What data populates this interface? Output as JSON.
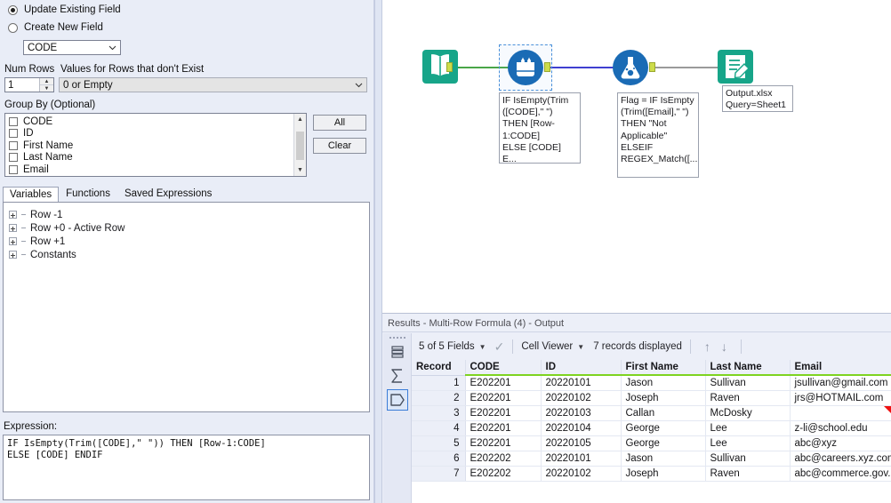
{
  "config_panel": {
    "radio_update": {
      "label": "Update Existing Field",
      "selected": true
    },
    "radio_create": {
      "label": "Create New  Field",
      "selected": false
    },
    "field_select": {
      "value": "CODE"
    },
    "num_rows": {
      "label": "Num Rows",
      "value": "1"
    },
    "values_for_rows": {
      "label": "Values for Rows that don't Exist",
      "value": "0 or Empty"
    },
    "group_by": {
      "label": "Group By (Optional)",
      "items": [
        {
          "label": "CODE",
          "checked": false
        },
        {
          "label": "ID",
          "checked": false
        },
        {
          "label": "First Name",
          "checked": false
        },
        {
          "label": "Last Name",
          "checked": false
        },
        {
          "label": "Email",
          "checked": false
        }
      ],
      "all_button": "All",
      "clear_button": "Clear"
    },
    "tabs": [
      {
        "label": "Variables",
        "active": true
      },
      {
        "label": "Functions",
        "active": false
      },
      {
        "label": "Saved Expressions",
        "active": false
      }
    ],
    "tree": [
      {
        "label": "Row -1"
      },
      {
        "label": "Row +0 - Active Row"
      },
      {
        "label": "Row +1"
      },
      {
        "label": "Constants"
      }
    ],
    "expression": {
      "label": "Expression:",
      "text": "IF IsEmpty(Trim([CODE],\" \")) THEN [Row-1:CODE]\nELSE [CODE] ENDIF"
    }
  },
  "canvas": {
    "nodes": [
      {
        "name": "input-data-tool",
        "icon": "book-icon",
        "annotation": "",
        "selected": false
      },
      {
        "name": "multi-row-formula-tool",
        "icon": "multi-row-formula-icon",
        "annotation": "IF IsEmpty(Trim\n([CODE],\" \")\nTHEN [Row-\n1:CODE]\nELSE [CODE] E...",
        "selected": true
      },
      {
        "name": "formula-tool",
        "icon": "flask-icon",
        "annotation": "Flag = IF IsEmpty\n(Trim([Email],\" \")\nTHEN \"Not\nApplicable\"\nELSEIF\nREGEX_Match([...",
        "selected": false
      },
      {
        "name": "output-data-tool",
        "icon": "document-pencil-icon",
        "annotation": "Output.xlsx\nQuery=Sheet1",
        "selected": false
      }
    ],
    "colors": {
      "tool_teal": "#17a589",
      "tool_blue": "#1a6bb5",
      "wire_green": "#4aa648",
      "wire_blue": "#3f3fd0",
      "wire_grey": "#9a9a9a",
      "port": "#cddc4a"
    }
  },
  "results": {
    "title": "Results - Multi-Row Formula (4) - Output",
    "toolbar": {
      "fields": "5 of 5 Fields",
      "viewer": "Cell Viewer",
      "records": "7 records displayed"
    },
    "rail": [
      {
        "name": "rail-list-icon",
        "selected": false
      },
      {
        "name": "rail-sigma-icon",
        "selected": false
      },
      {
        "name": "rail-data-icon",
        "selected": true
      }
    ],
    "grid": {
      "columns": [
        "Record",
        "CODE",
        "ID",
        "First Name",
        "Last Name",
        "Email"
      ],
      "rows": [
        {
          "record": "1",
          "code": "E202201",
          "id": "20220101",
          "first": "Jason",
          "last": "Sullivan",
          "email": "jsullivan@gmail.com",
          "flag": false
        },
        {
          "record": "2",
          "code": "E202201",
          "id": "20220102",
          "first": "Joseph",
          "last": "Raven",
          "email": "jrs@HOTMAIL.com",
          "flag": false
        },
        {
          "record": "3",
          "code": "E202201",
          "id": "20220103",
          "first": "Callan",
          "last": "McDosky",
          "email": "",
          "flag": true
        },
        {
          "record": "4",
          "code": "E202201",
          "id": "20220104",
          "first": "George",
          "last": "Lee",
          "email": "z-li@school.edu",
          "flag": false
        },
        {
          "record": "5",
          "code": "E202201",
          "id": "20220105",
          "first": "George",
          "last": "Lee",
          "email": "abc@xyz",
          "flag": false
        },
        {
          "record": "6",
          "code": "E202202",
          "id": "20220101",
          "first": "Jason",
          "last": "Sullivan",
          "email": "abc@careers.xyz.com",
          "flag": false
        },
        {
          "record": "7",
          "code": "E202202",
          "id": "20220102",
          "first": "Joseph",
          "last": "Raven",
          "email": "abc@commerce.gov.cn",
          "flag": false
        }
      ]
    }
  }
}
